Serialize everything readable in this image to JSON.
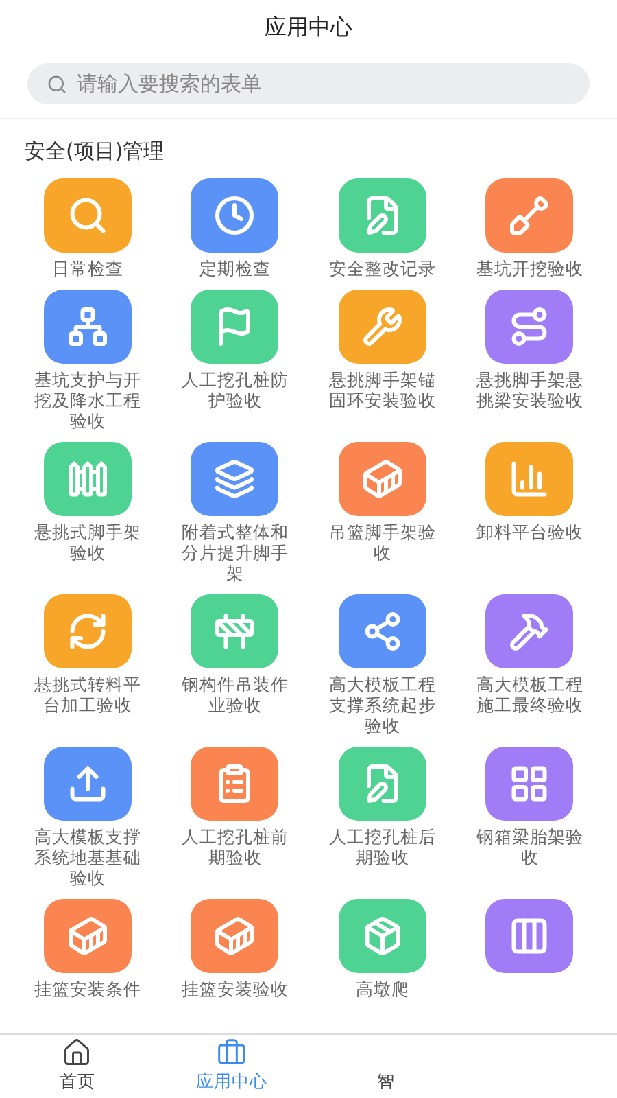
{
  "header": {
    "title": "应用中心"
  },
  "search": {
    "placeholder": "请输入要搜索的表单"
  },
  "section": {
    "title": "安全(项目)管理",
    "apps": [
      {
        "label": "日常检查",
        "color": "#f8a62a"
      },
      {
        "label": "定期检查",
        "color": "#5a92f7"
      },
      {
        "label": "安全整改记录",
        "color": "#4fd393"
      },
      {
        "label": "基坑开挖验收",
        "color": "#fb8550"
      },
      {
        "label": "基坑支护与开挖及降水工程验收",
        "color": "#5a92f7"
      },
      {
        "label": "人工挖孔桩防护验收",
        "color": "#4fd393"
      },
      {
        "label": "悬挑脚手架锚固环安装验收",
        "color": "#f8a62a"
      },
      {
        "label": "悬挑脚手架悬挑梁安装验收",
        "color": "#a07cf6"
      },
      {
        "label": "悬挑式脚手架验收",
        "color": "#4fd393"
      },
      {
        "label": "附着式整体和分片提升脚手架",
        "color": "#5a92f7"
      },
      {
        "label": "吊篮脚手架验收",
        "color": "#fb8550"
      },
      {
        "label": "卸料平台验收",
        "color": "#f8a62a"
      },
      {
        "label": "悬挑式转料平台加工验收",
        "color": "#f8a62a"
      },
      {
        "label": "钢构件吊装作业验收",
        "color": "#4fd393"
      },
      {
        "label": "高大模板工程支撑系统起步验收",
        "color": "#5a92f7"
      },
      {
        "label": "高大模板工程施工最终验收",
        "color": "#a07cf6"
      },
      {
        "label": "高大模板支撑系统地基基础验收",
        "color": "#5a92f7"
      },
      {
        "label": "人工挖孔桩前期验收",
        "color": "#fb8550"
      },
      {
        "label": "人工挖孔桩后期验收",
        "color": "#4fd393"
      },
      {
        "label": "钢箱梁胎架验收",
        "color": "#a07cf6"
      },
      {
        "label": "挂篮安装条件",
        "color": "#fb8550"
      },
      {
        "label": "挂篮安装验收",
        "color": "#fb8550"
      },
      {
        "label": "高墩爬",
        "color": "#4fd393"
      },
      {
        "color": "#a07cf6"
      }
    ]
  },
  "tab_bar": [
    {
      "label": "首页",
      "selected": false
    },
    {
      "label": "应用中心",
      "selected": true
    },
    {
      "label": "智",
      "selected": false
    }
  ]
}
